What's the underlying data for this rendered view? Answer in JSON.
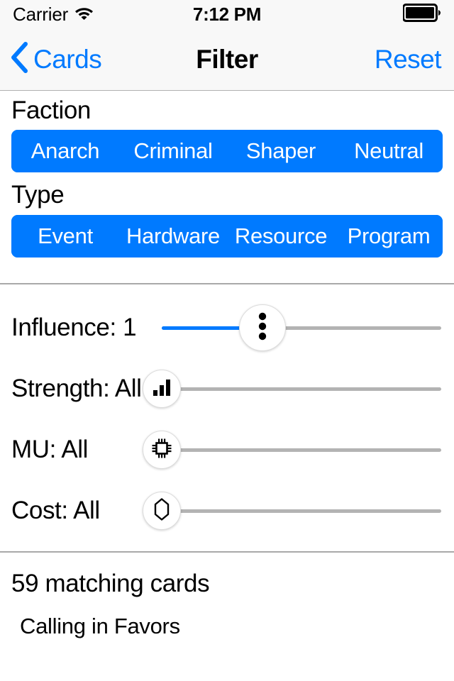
{
  "status_bar": {
    "carrier": "Carrier",
    "wifi_icon": "wifi-icon",
    "time": "7:12 PM",
    "battery_icon": "battery-full-icon"
  },
  "nav_bar": {
    "back_label": "Cards",
    "back_icon": "chevron-left-icon",
    "title": "Filter",
    "reset_label": "Reset"
  },
  "colors": {
    "accent": "#007aff",
    "track_inactive": "#b3b3b3",
    "nav_background": "#f8f8f8",
    "separator": "#a9a9a9"
  },
  "faction": {
    "heading": "Faction",
    "segments": [
      {
        "label": "Anarch",
        "selected": true
      },
      {
        "label": "Criminal",
        "selected": true
      },
      {
        "label": "Shaper",
        "selected": true
      },
      {
        "label": "Neutral",
        "selected": true
      }
    ]
  },
  "type": {
    "heading": "Type",
    "segments": [
      {
        "label": "Event",
        "selected": true
      },
      {
        "label": "Hardware",
        "selected": true
      },
      {
        "label": "Resource",
        "selected": true
      },
      {
        "label": "Program",
        "selected": true
      }
    ]
  },
  "sliders": [
    {
      "name": "influence",
      "label": "Influence: 1",
      "value": "1",
      "fill_percent": 36,
      "thumb_percent": 36,
      "thumb_size": "large",
      "icon": "influence-pips-icon"
    },
    {
      "name": "strength",
      "label": "Strength: All",
      "value": "All",
      "fill_percent": 0,
      "thumb_percent": 0,
      "thumb_size": "small",
      "icon": "strength-bars-icon"
    },
    {
      "name": "mu",
      "label": "MU: All",
      "value": "All",
      "fill_percent": 0,
      "thumb_percent": 0,
      "thumb_size": "small",
      "icon": "memory-chip-icon"
    },
    {
      "name": "cost",
      "label": "Cost: All",
      "value": "All",
      "fill_percent": 0,
      "thumb_percent": 0,
      "thumb_size": "small",
      "icon": "credit-hexagon-icon"
    }
  ],
  "results": {
    "count_label": "59 matching cards",
    "items": [
      {
        "name": "Calling in Favors"
      }
    ]
  }
}
